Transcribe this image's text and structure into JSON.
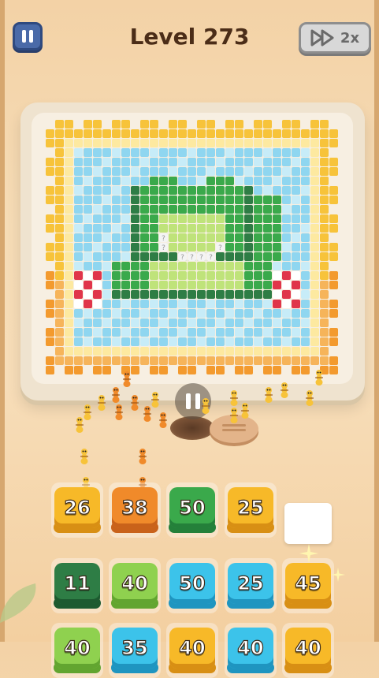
{
  "header": {
    "level_title": "Level 273",
    "speed_label": "2x"
  },
  "colors": {
    "yellow": "#f7b928",
    "orange": "#f08a2a",
    "green": "#3aa94b",
    "dark_green": "#2e7d45",
    "lime": "#8fd14f",
    "cyan": "#3cc3ea"
  },
  "trays": {
    "row1": [
      {
        "label": "26",
        "color": "yellow"
      },
      {
        "label": "38",
        "color": "orange"
      },
      {
        "label": "50",
        "color": "green"
      },
      {
        "label": "25",
        "color": "yellow"
      }
    ],
    "row2": [
      {
        "label": "11",
        "color": "dark_green"
      },
      {
        "label": "40",
        "color": "lime"
      },
      {
        "label": "50",
        "color": "cyan"
      },
      {
        "label": "25",
        "color": "cyan"
      },
      {
        "label": "45",
        "color": "yellow"
      }
    ],
    "row3": [
      {
        "label": "40",
        "color": "lime"
      },
      {
        "label": "35",
        "color": "cyan"
      },
      {
        "label": "40",
        "color": "yellow"
      },
      {
        "label": "40",
        "color": "cyan"
      },
      {
        "label": "40",
        "color": "yellow"
      }
    ]
  },
  "puzzle": {
    "subject": "frog on lily pad",
    "unknown_marker": "?"
  },
  "icons": {
    "pause": "pause-icon",
    "fast_forward": "fast-forward-icon"
  }
}
